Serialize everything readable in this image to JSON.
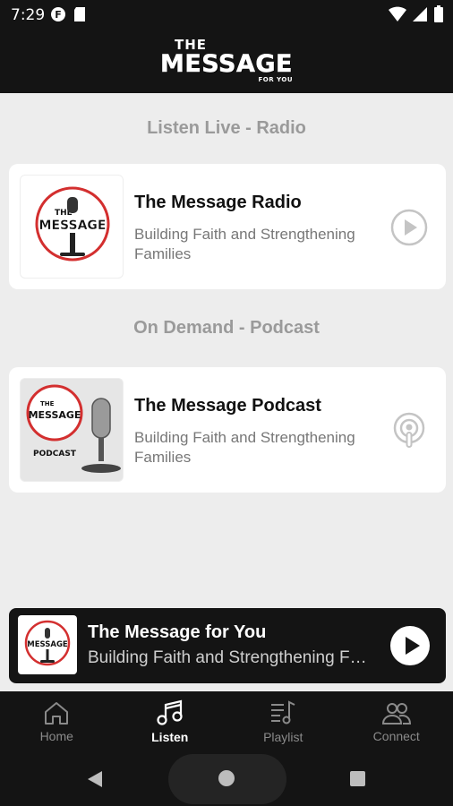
{
  "status_bar": {
    "time": "7:29"
  },
  "header": {
    "logo_the": "THE",
    "logo_message": "MESSAGE",
    "logo_foryou": "FOR YOU"
  },
  "sections": {
    "live_title": "Listen Live - Radio",
    "demand_title": "On Demand - Podcast"
  },
  "cards": [
    {
      "title": "The Message Radio",
      "subtitle": "Building Faith and Strengthening Families",
      "action_icon": "play-circle-icon"
    },
    {
      "title": "The Message Podcast",
      "subtitle": "Building Faith and Strengthening Families",
      "action_icon": "podcast-icon"
    }
  ],
  "thumb_text": {
    "the": "THE",
    "message": "MESSAGE",
    "podcast": "PODCAST"
  },
  "mini_player": {
    "title": "The Message for You",
    "subtitle": "Building Faith and Strengthening Families"
  },
  "bottom_nav": [
    {
      "label": "Home",
      "icon": "home-icon",
      "active": false
    },
    {
      "label": "Listen",
      "icon": "music-note-icon",
      "active": true
    },
    {
      "label": "Playlist",
      "icon": "playlist-icon",
      "active": false
    },
    {
      "label": "Connect",
      "icon": "people-icon",
      "active": false
    }
  ],
  "colors": {
    "background": "#ededed",
    "dark": "#141414",
    "accent_red": "#d32f2f",
    "muted_text": "#9a9a9a"
  }
}
